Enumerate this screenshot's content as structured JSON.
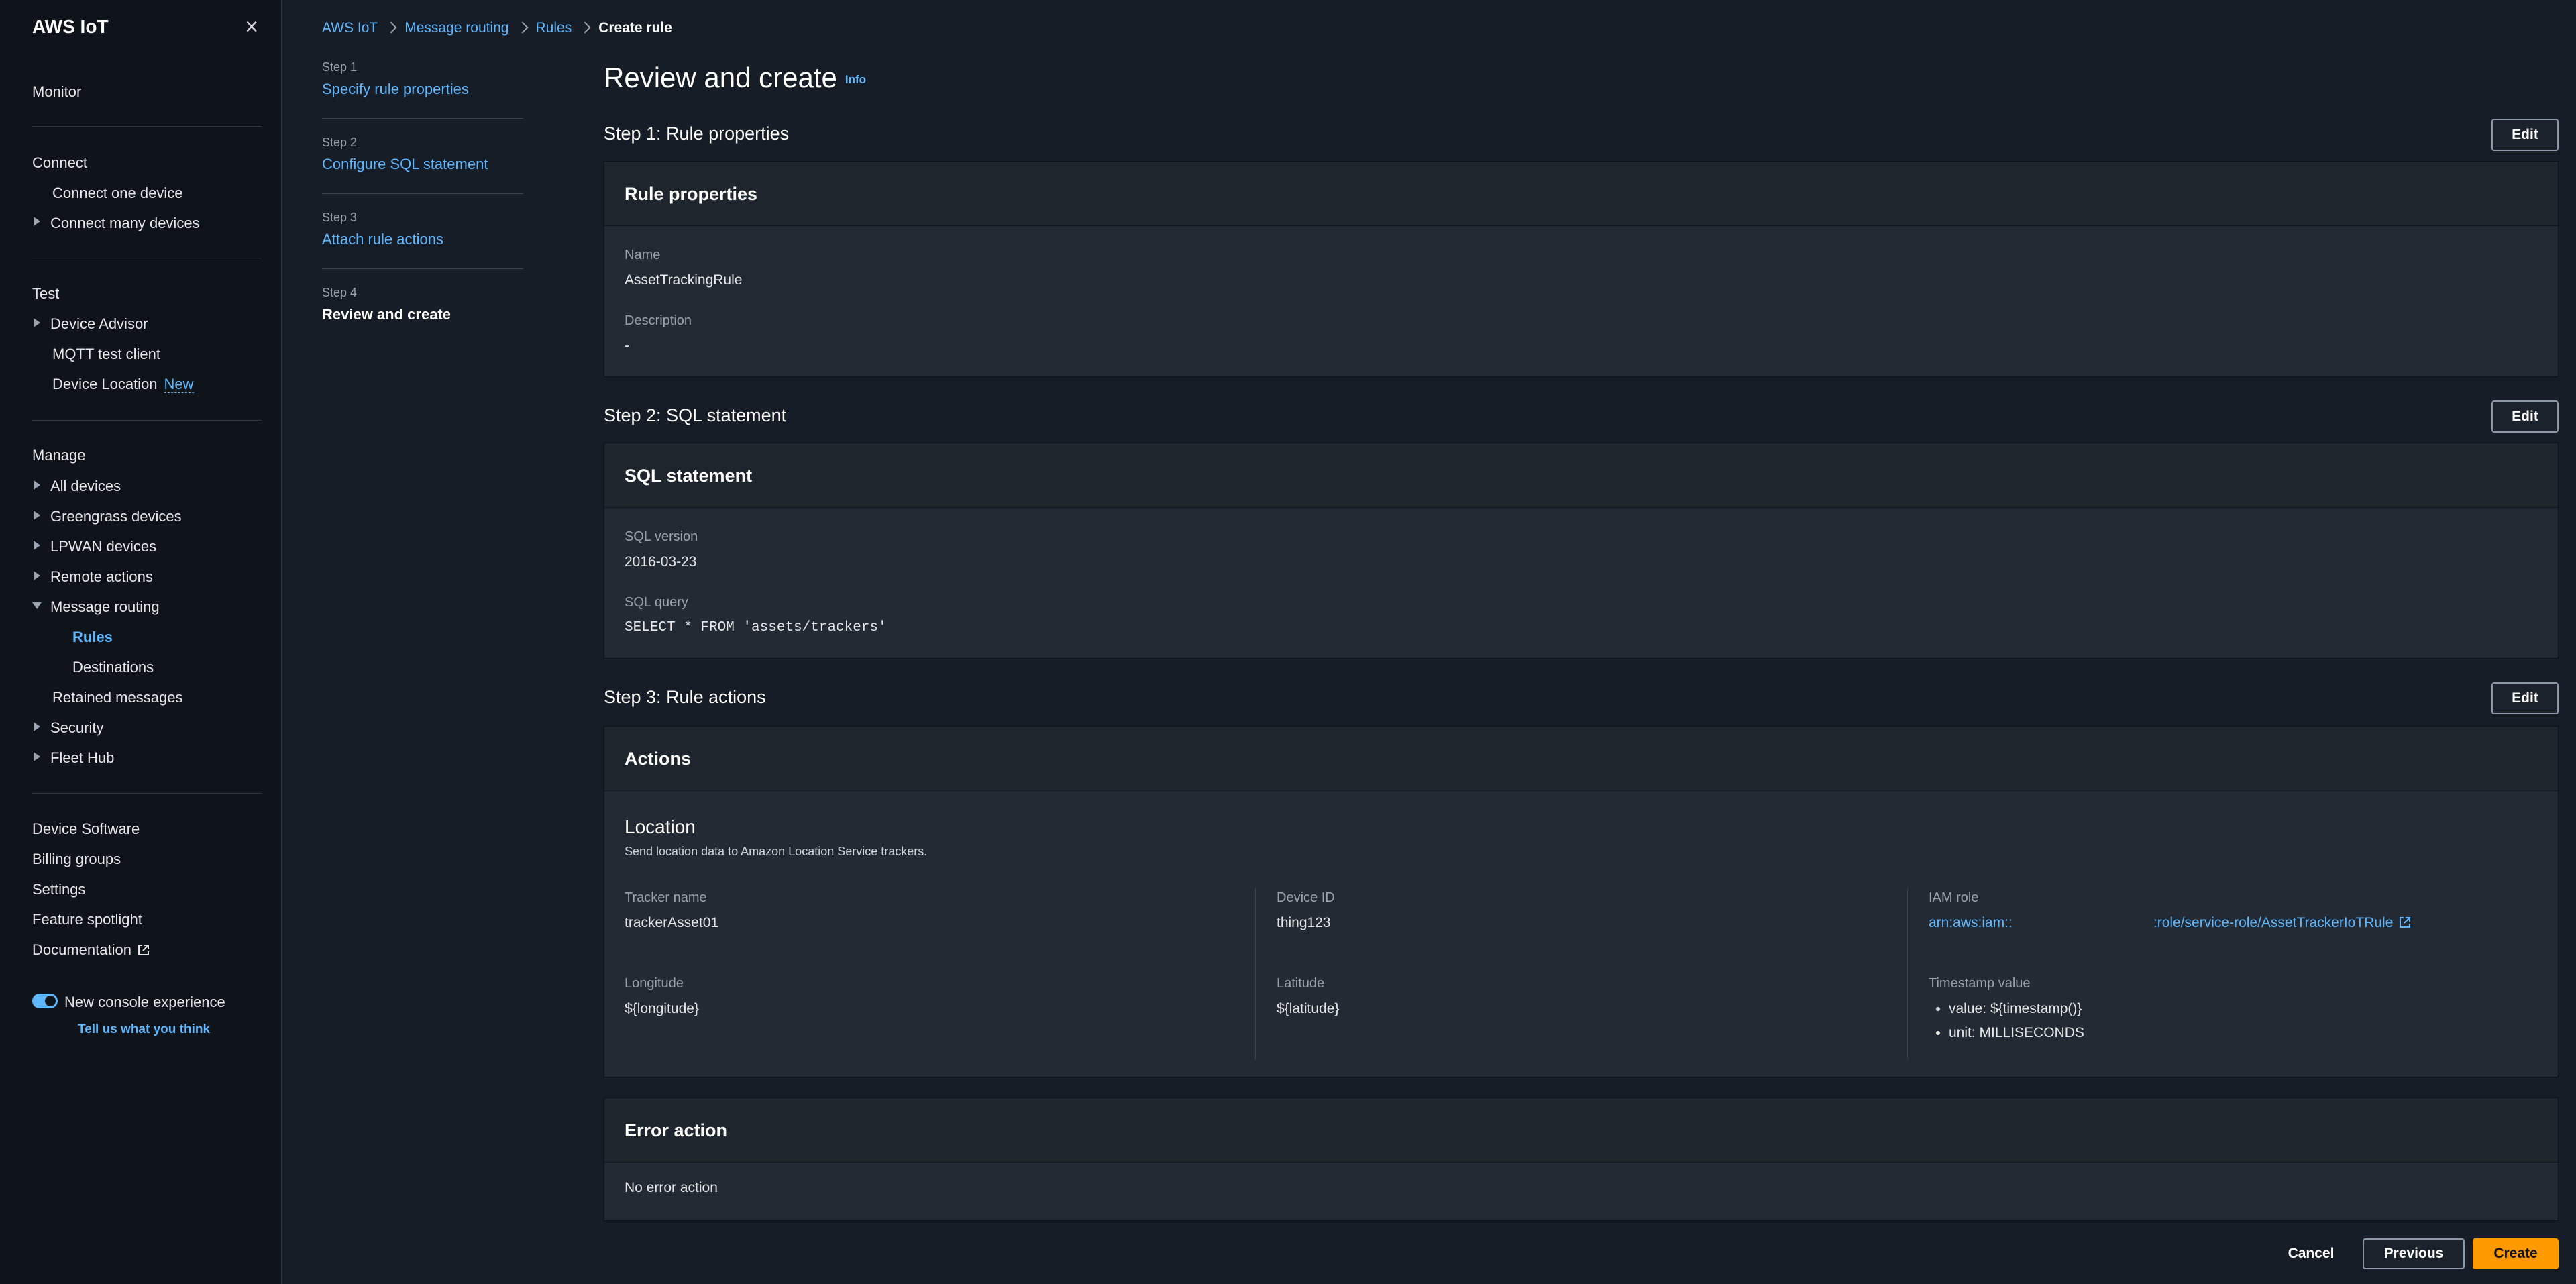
{
  "sidebar": {
    "title": "AWS IoT",
    "monitor": "Monitor",
    "connect": {
      "heading": "Connect",
      "items": [
        "Connect one device",
        "Connect many devices"
      ]
    },
    "test": {
      "heading": "Test",
      "items": [
        "Device Advisor",
        "MQTT test client",
        "Device Location"
      ],
      "new_badge": "New"
    },
    "manage": {
      "heading": "Manage",
      "items": [
        "All devices",
        "Greengrass devices",
        "LPWAN devices",
        "Remote actions",
        "Message routing",
        "Rules",
        "Destinations",
        "Retained messages",
        "Security",
        "Fleet Hub"
      ]
    },
    "footer_items": [
      "Device Software",
      "Billing groups",
      "Settings",
      "Feature spotlight",
      "Documentation"
    ],
    "toggle_label": "New console experience",
    "feedback": "Tell us what you think"
  },
  "breadcrumb": [
    "AWS IoT",
    "Message routing",
    "Rules",
    "Create rule"
  ],
  "steps": [
    {
      "num": "Step 1",
      "label": "Specify rule properties"
    },
    {
      "num": "Step 2",
      "label": "Configure SQL statement"
    },
    {
      "num": "Step 3",
      "label": "Attach rule actions"
    },
    {
      "num": "Step 4",
      "label": "Review and create"
    }
  ],
  "page": {
    "title": "Review and create",
    "info": "Info",
    "edit_label": "Edit"
  },
  "step1": {
    "heading": "Step 1: Rule properties",
    "panel_title": "Rule properties",
    "name_label": "Name",
    "name_value": "AssetTrackingRule",
    "desc_label": "Description",
    "desc_value": "-"
  },
  "step2": {
    "heading": "Step 2: SQL statement",
    "panel_title": "SQL statement",
    "version_label": "SQL version",
    "version_value": "2016-03-23",
    "query_label": "SQL query",
    "query_value": "SELECT * FROM 'assets/trackers'"
  },
  "step3": {
    "heading": "Step 3: Rule actions",
    "panel_title": "Actions",
    "location_title": "Location",
    "location_desc": "Send location data to Amazon Location Service trackers.",
    "tracker_label": "Tracker name",
    "tracker_value": "trackerAsset01",
    "device_label": "Device ID",
    "device_value": "thing123",
    "iam_label": "IAM role",
    "iam_value_prefix": "arn:aws:iam::",
    "iam_value_suffix": ":role/service-role/AssetTrackerIoTRule",
    "longitude_label": "Longitude",
    "longitude_value": "${longitude}",
    "latitude_label": "Latitude",
    "latitude_value": "${latitude}",
    "timestamp_label": "Timestamp value",
    "timestamp_items": [
      "value: ${timestamp()}",
      "unit: MILLISECONDS"
    ]
  },
  "error_action": {
    "panel_title": "Error action",
    "value": "No error action"
  },
  "footer": {
    "cancel": "Cancel",
    "previous": "Previous",
    "create": "Create"
  },
  "colors": {
    "accent": "#5fb8ff",
    "primary_button": "#ff9900"
  }
}
